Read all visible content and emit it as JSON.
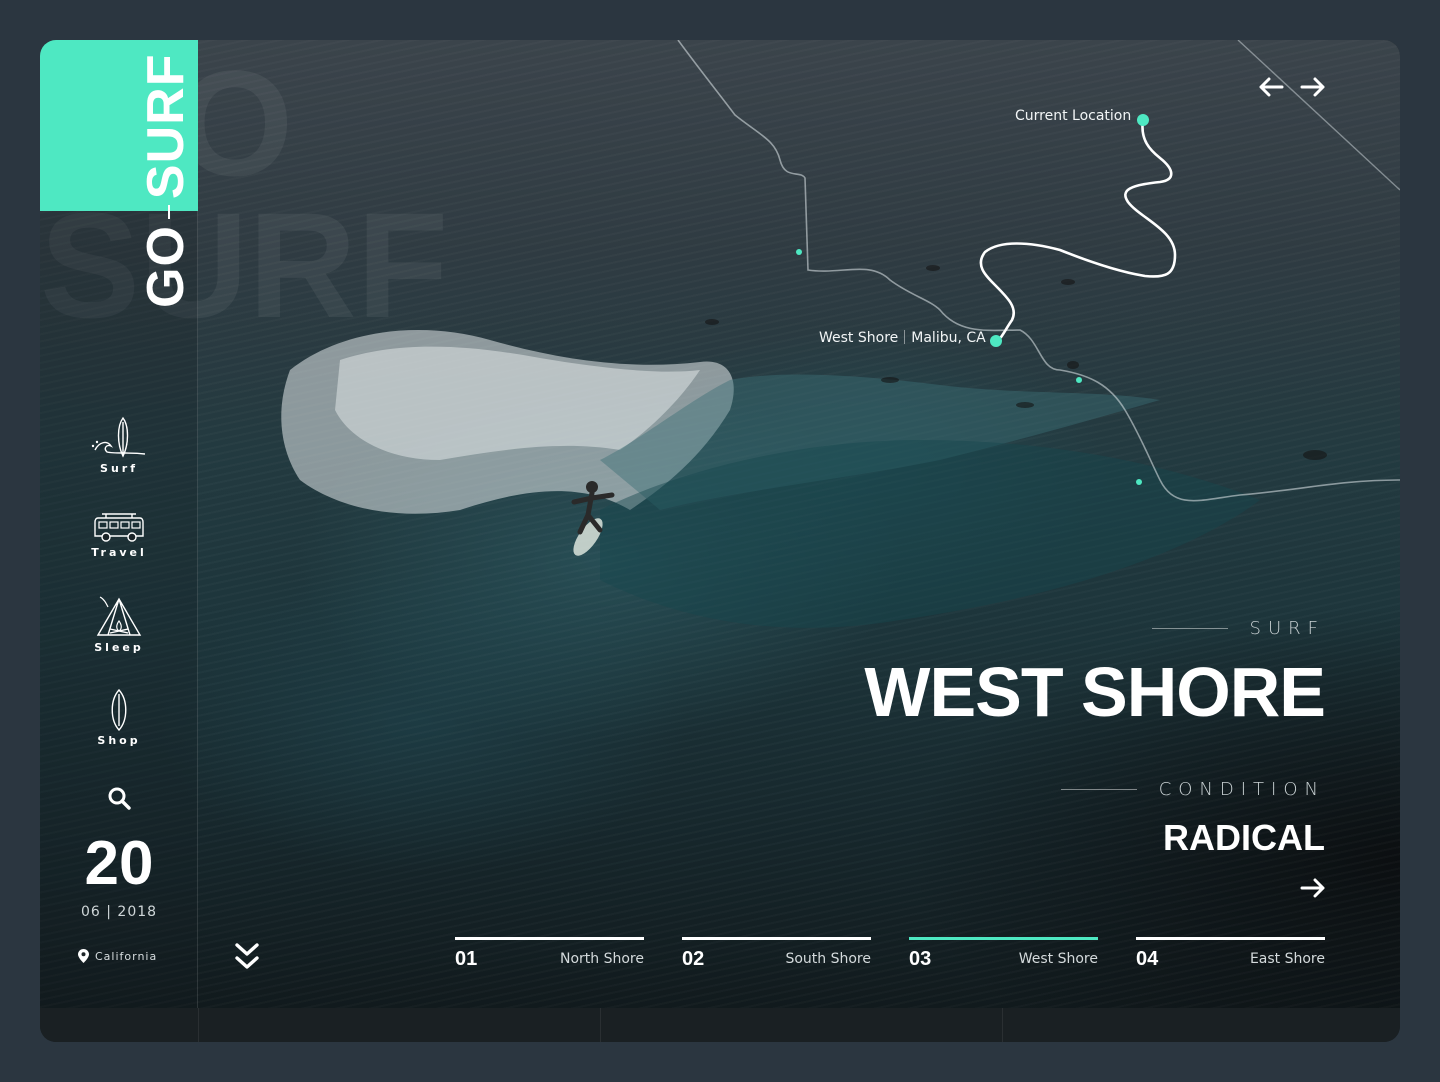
{
  "brand": {
    "name_top": "GO",
    "name_bottom": "SURF",
    "ghost_1": "GO",
    "ghost_2": "SURF",
    "accent": "#4ee8c2"
  },
  "nav": {
    "items": [
      {
        "label": "Surf",
        "icon": "surfboard-wave-icon"
      },
      {
        "label": "Travel",
        "icon": "camper-van-icon"
      },
      {
        "label": "Sleep",
        "icon": "tent-campfire-icon"
      },
      {
        "label": "Shop",
        "icon": "surfboard-icon"
      }
    ],
    "search_icon": "search-icon"
  },
  "date": {
    "day": "20",
    "month": "06",
    "year": "2018"
  },
  "location": {
    "label": "California",
    "icon": "map-pin-icon"
  },
  "map": {
    "current_location": "Current Location",
    "spot_name": "West Shore",
    "spot_place": "Malibu, CA"
  },
  "hero": {
    "kicker": "SURF",
    "title": "WEST SHORE",
    "condition_label": "CONDITION",
    "condition_value": "RADICAL"
  },
  "controls": {
    "prev_icon": "arrow-left-icon",
    "next_icon": "arrow-right-icon",
    "scroll_icon": "chevron-double-down-icon"
  },
  "spots": [
    {
      "num": "01",
      "name": "North Shore",
      "active": false
    },
    {
      "num": "02",
      "name": "South Shore",
      "active": false
    },
    {
      "num": "03",
      "name": "West Shore",
      "active": true
    },
    {
      "num": "04",
      "name": "East Shore",
      "active": false
    }
  ]
}
